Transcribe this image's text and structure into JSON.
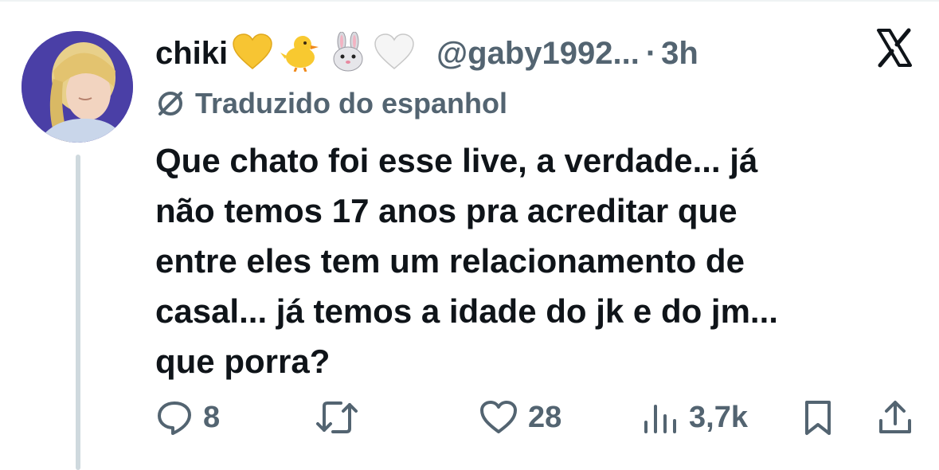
{
  "tweet": {
    "author_name": "chiki",
    "author_emojis": [
      "yellow-heart",
      "hatching-chick",
      "rabbit-face",
      "white-heart"
    ],
    "handle": "@gaby1992...",
    "separator": "·",
    "time": "3h",
    "translated_label": "Traduzido do espanhol",
    "text_lines": [
      "Que chato foi esse live, a verdade... já",
      "não temos 17 anos pra acreditar que",
      "entre eles tem um relacionamento de",
      "casal... já temos a idade do jk e do jm...",
      "que porra?"
    ]
  },
  "actions": {
    "reply_count": "8",
    "retweet_count": "",
    "like_count": "28",
    "views_count": "3,7k"
  },
  "colors": {
    "text": "#0f1419",
    "secondary": "#536471",
    "thread_line": "#cfd9de",
    "avatar_bg": "#4a3fa6"
  }
}
